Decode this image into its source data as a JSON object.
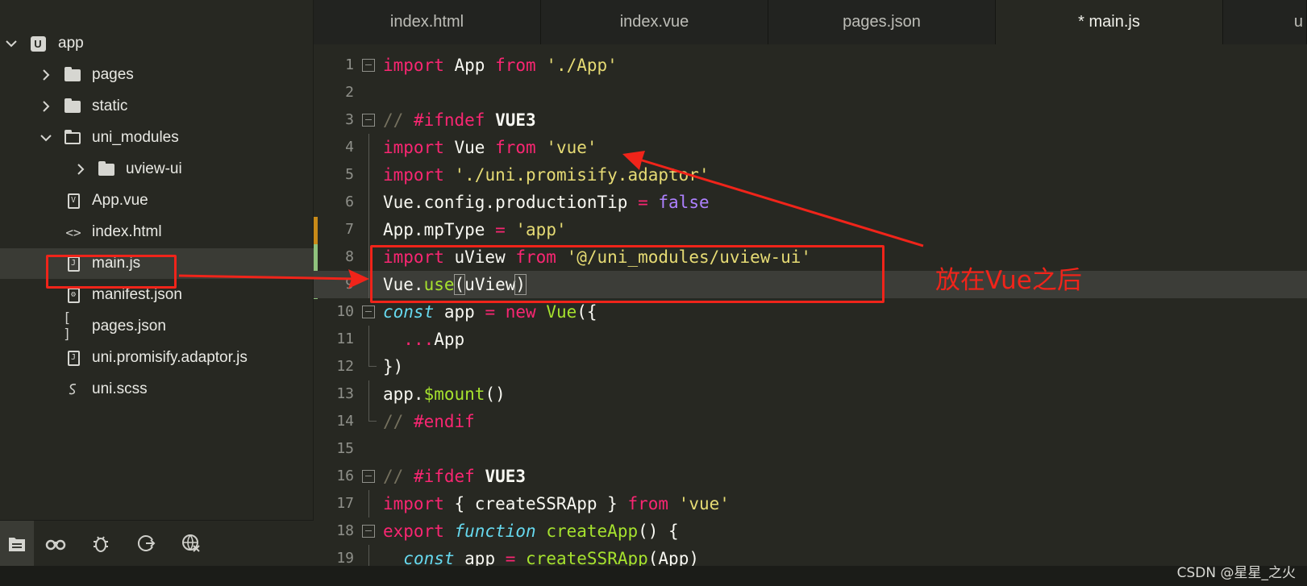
{
  "sidebar": {
    "items": [
      {
        "label": "app",
        "icon": "app-project-icon",
        "chevron": "chevron-down-icon"
      },
      {
        "label": "pages",
        "icon": "folder-icon",
        "chevron": "chevron-right-icon"
      },
      {
        "label": "static",
        "icon": "folder-icon",
        "chevron": "chevron-right-icon"
      },
      {
        "label": "uni_modules",
        "icon": "folder-open-icon",
        "chevron": "chevron-down-icon"
      },
      {
        "label": "uview-ui",
        "icon": "folder-icon",
        "chevron": "chevron-right-icon"
      },
      {
        "label": "App.vue",
        "icon": "vue-file-icon"
      },
      {
        "label": "index.html",
        "icon": "html-file-icon"
      },
      {
        "label": "main.js",
        "icon": "js-file-icon"
      },
      {
        "label": "manifest.json",
        "icon": "settings-file-icon"
      },
      {
        "label": "pages.json",
        "icon": "json-file-icon"
      },
      {
        "label": "uni.promisify.adaptor.js",
        "icon": "js-file-icon"
      },
      {
        "label": "uni.scss",
        "icon": "scss-file-icon"
      }
    ],
    "tools": [
      "explorer-icon",
      "search-icon",
      "debug-icon",
      "git-icon",
      "extensions-icon"
    ]
  },
  "tabs": [
    {
      "label": "index.html"
    },
    {
      "label": "index.vue"
    },
    {
      "label": "pages.json"
    },
    {
      "label": "* main.js"
    },
    {
      "label": "u"
    }
  ],
  "editor": {
    "line_numbers": [
      "1",
      "2",
      "3",
      "4",
      "5",
      "6",
      "7",
      "8",
      "9",
      "10",
      "11",
      "12",
      "13",
      "14",
      "15",
      "16",
      "17",
      "18",
      "19"
    ]
  },
  "annotation": {
    "text": "放在Vue之后",
    "color": "#f0241a"
  },
  "watermark": "CSDN @星星_之火",
  "colors": {
    "background": "#272822",
    "keyword": "#f92672",
    "string": "#e6db74",
    "comment": "#75715e",
    "function": "#a6e22e",
    "boolean": "#ae81ff"
  }
}
